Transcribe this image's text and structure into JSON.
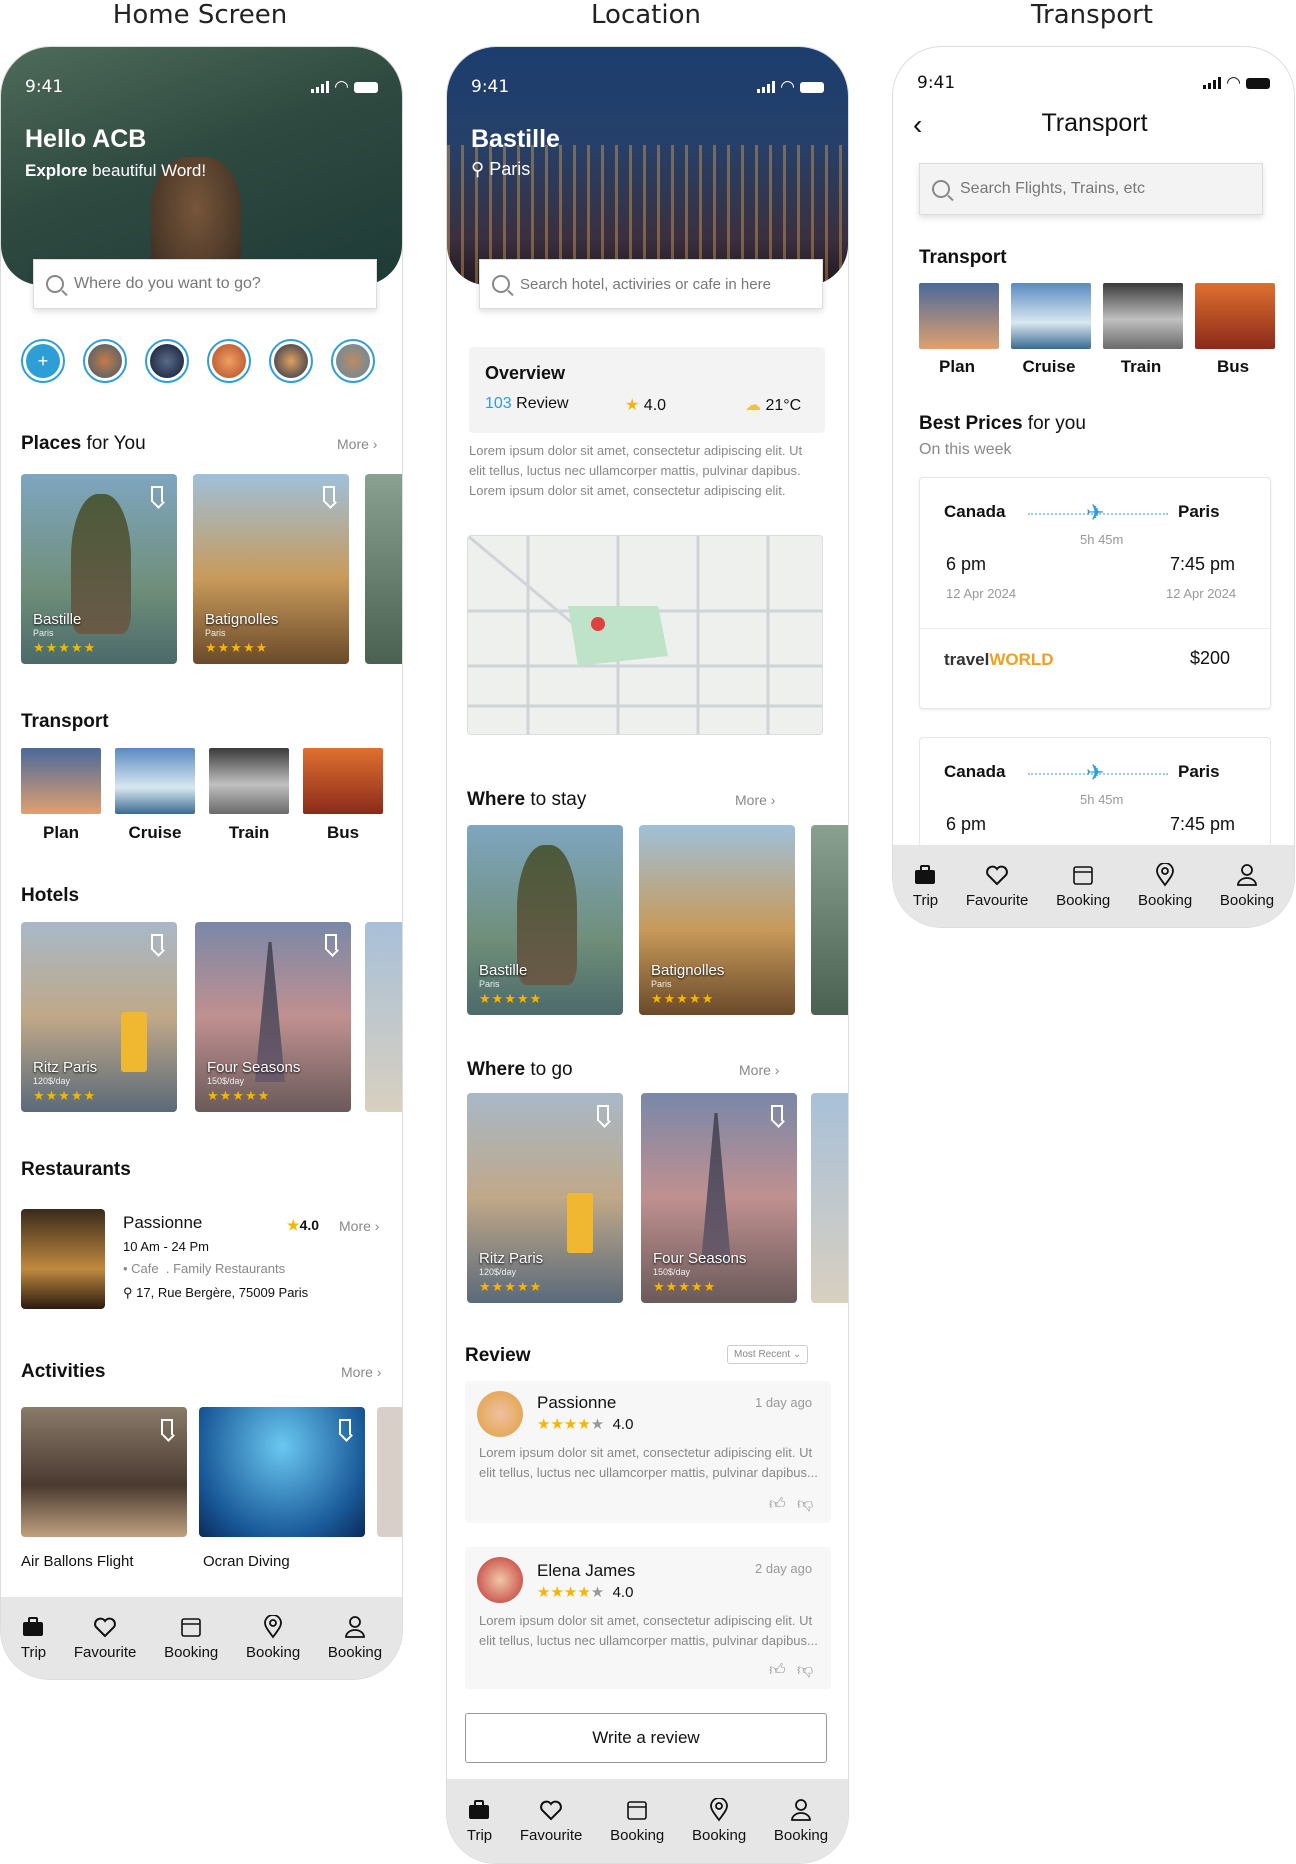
{
  "titles": {
    "home": "Home Screen",
    "location": "Location",
    "transport": "Transport"
  },
  "status": {
    "time": "9:41"
  },
  "home": {
    "hello": "Hello ACB",
    "explore_bold": "Explore",
    "explore_rest": " beautiful Word!",
    "search_placeholder": "Where do you want to go?",
    "story_add": "+",
    "places_title": "Places",
    "places_rest": " for You",
    "more": "More",
    "places": [
      {
        "name": "Bastille",
        "sub": "Paris",
        "stars": "★★★★★"
      },
      {
        "name": "Batignolles",
        "sub": "Paris",
        "stars": "★★★★★"
      }
    ],
    "transport_title": "Transport",
    "transport": [
      "Plan",
      "Cruise",
      "Train",
      "Bus"
    ],
    "hotels_title": "Hotels",
    "hotels": [
      {
        "name": "Ritz Paris",
        "sub": "120$/day",
        "stars": "★★★★★"
      },
      {
        "name": "Four Seasons",
        "sub": "150$/day",
        "stars": "★★★★★"
      }
    ],
    "restaurants_title": "Restaurants",
    "restaurant": {
      "name": "Passionne",
      "rating": "4.0",
      "hours": "10 Am - 24 Pm",
      "cat1": "Cafe",
      "cat2": "Family Restaurants",
      "address": "17, Rue Bergère, 75009 Paris"
    },
    "activities_title": "Activities",
    "activities": [
      "Air Ballons Flight",
      "Ocran Diving"
    ]
  },
  "nav": [
    "Trip",
    "Favourite",
    "Booking",
    "Booking",
    "Booking"
  ],
  "location": {
    "title": "Bastille",
    "subtitle": "Paris",
    "search_placeholder": "Search hotel, activiries or cafe in here",
    "overview_title": "Overview",
    "review_count": "103",
    "review_word": " Review",
    "rating": "4.0",
    "temp": "21°C",
    "lorem": "Lorem ipsum dolor sit amet, consectetur adipiscing elit. Ut elit tellus, luctus nec ullamcorper mattis, pulvinar dapibus. Lorem ipsum dolor sit amet, consectetur adipiscing elit.",
    "stay_title": "Where",
    "stay_rest": " to stay",
    "go_title": "Where",
    "go_rest": " to go",
    "review_title": "Review",
    "sort": "Most Recent",
    "reviews": [
      {
        "name": "Passionne",
        "time": "1 day ago",
        "rating": "4.0",
        "text": "Lorem ipsum dolor sit amet, consectetur adipiscing elit. Ut elit tellus, luctus nec ullamcorper mattis, pulvinar dapibus..."
      },
      {
        "name": "Elena James",
        "time": "2 day ago",
        "rating": "4.0",
        "text": "Lorem ipsum dolor sit amet, consectetur adipiscing elit. Ut elit tellus, luctus nec ullamcorper mattis, pulvinar dapibus..."
      }
    ],
    "write_review": "Write a review"
  },
  "transport": {
    "title": "Transport",
    "search_placeholder": "Search Flights, Trains, etc",
    "section": "Transport",
    "items": [
      "Plan",
      "Cruise",
      "Train",
      "Bus"
    ],
    "best_bold": "Best Prices",
    "best_rest": " for you",
    "week": "On this week",
    "tickets": [
      {
        "from": "Canada",
        "to": "Paris",
        "duration": "5h 45m",
        "dep": "6 pm",
        "arr": "7:45 pm",
        "dep_date": "12 Apr 2024",
        "arr_date": "12 Apr 2024",
        "brand_a": "travel",
        "brand_b": "WORLD",
        "price": "$200"
      },
      {
        "from": "Canada",
        "to": "Paris",
        "duration": "5h 45m",
        "dep": "6 pm",
        "arr": "7:45 pm"
      }
    ]
  },
  "colors": {
    "accent": "#2e9ed6",
    "star": "#f6b500",
    "nav": "#e6e6e6"
  }
}
